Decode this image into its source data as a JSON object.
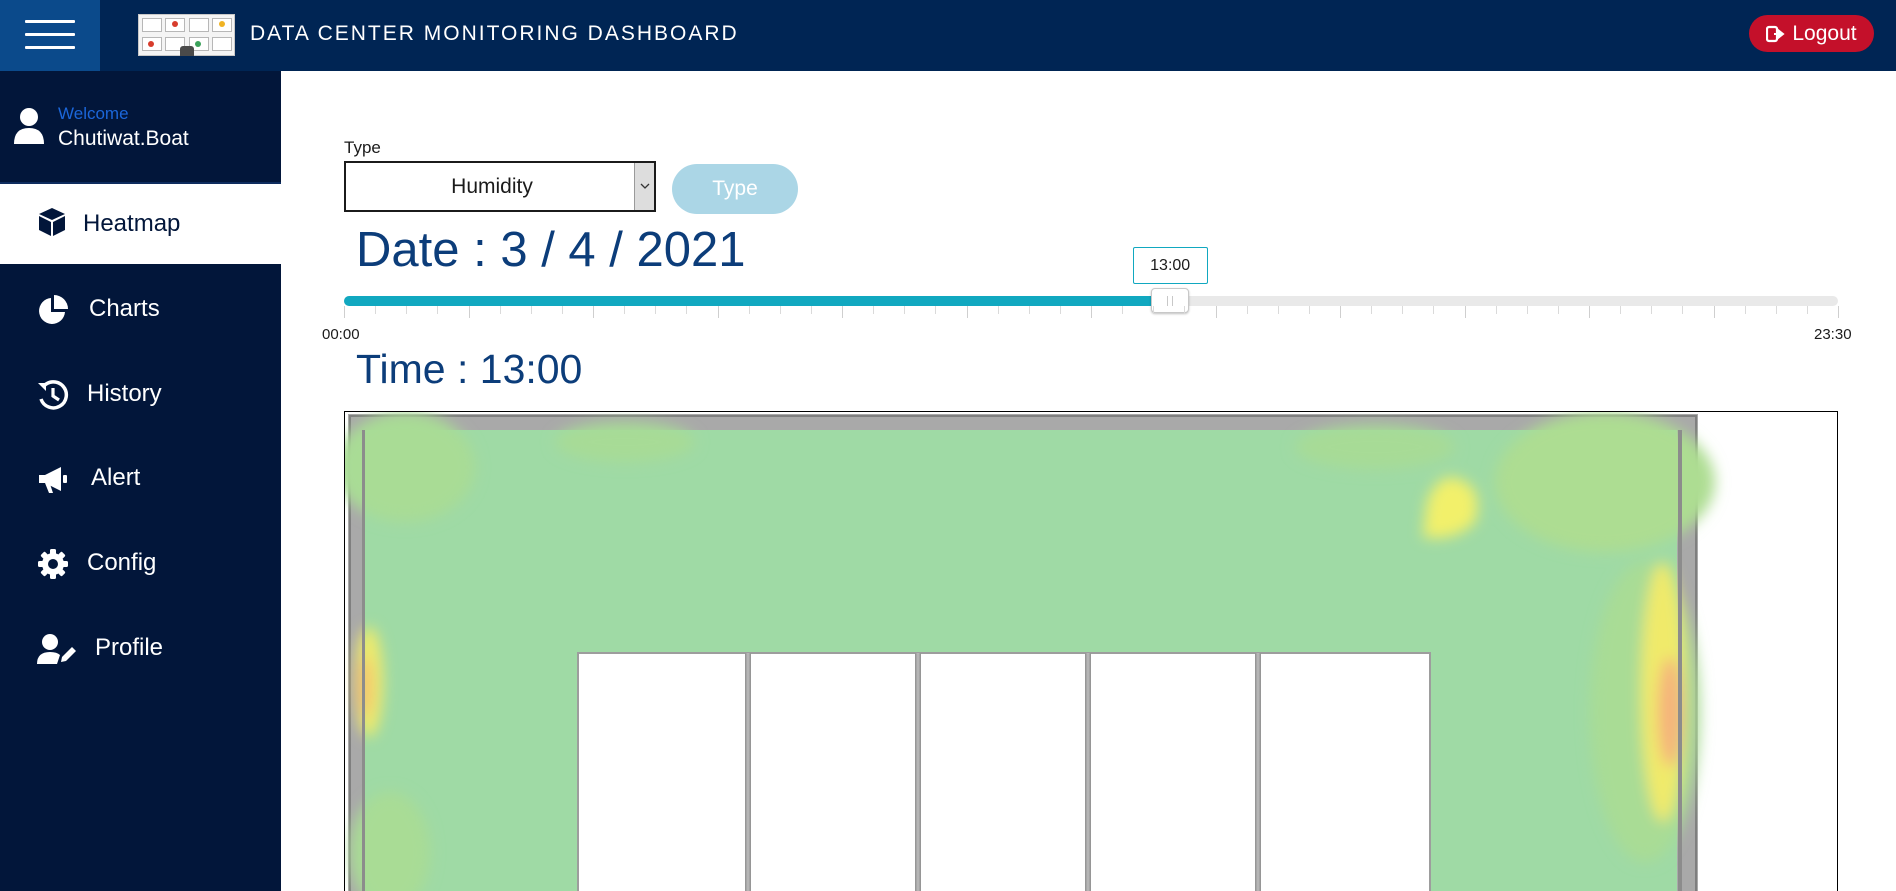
{
  "app": {
    "title": "DATA CENTER MONITORING DASHBOARD",
    "logout_label": "Logout"
  },
  "user": {
    "welcome": "Welcome",
    "name": "Chutiwat.Boat"
  },
  "sidebar": {
    "items": [
      {
        "label": "Heatmap",
        "icon": "cube-icon",
        "active": true
      },
      {
        "label": "Charts",
        "icon": "pie-chart-icon",
        "active": false
      },
      {
        "label": "History",
        "icon": "history-icon",
        "active": false
      },
      {
        "label": "Alert",
        "icon": "megaphone-icon",
        "active": false
      },
      {
        "label": "Config",
        "icon": "gear-icon",
        "active": false
      },
      {
        "label": "Profile",
        "icon": "user-edit-icon",
        "active": false
      }
    ]
  },
  "filters": {
    "type_label": "Type",
    "type_value": "Humidity",
    "type_button": "Type"
  },
  "date_text": "Date : 3 / 4 / 2021",
  "time_text": "Time : 13:00",
  "slider": {
    "min_label": "00:00",
    "max_label": "23:30",
    "value_label": "13:00",
    "value_fraction": 0.553
  },
  "colors": {
    "topbar": "#002554",
    "sidebar": "#02163a",
    "accent": "#11a8c0",
    "logout": "#c4102a",
    "heat_base": "#9fdaa5"
  }
}
